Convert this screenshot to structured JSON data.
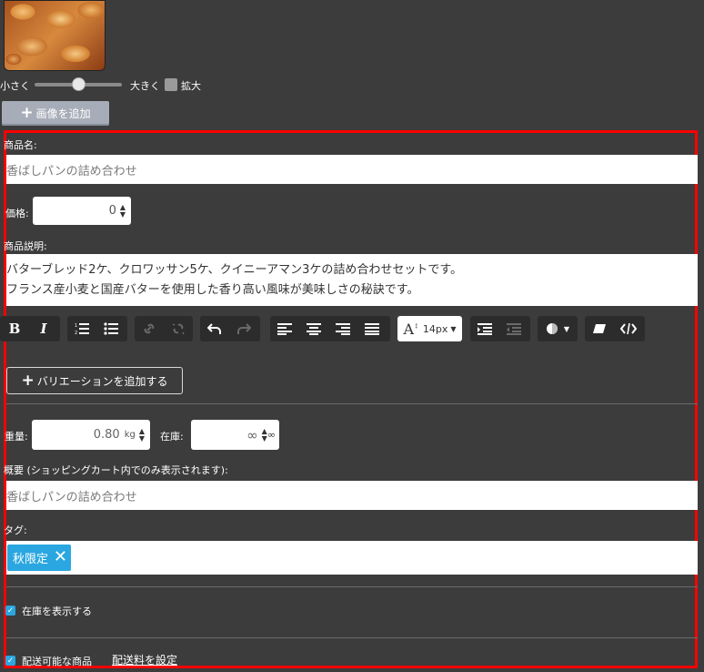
{
  "image_controls": {
    "small_label": "小さく",
    "large_label": "大きく",
    "zoom_label": "拡大",
    "slider_level": 0.5,
    "add_image_label": "画像を追加"
  },
  "product": {
    "name_label": "商品名:",
    "name_value": "香ばしパンの詰め合わせ",
    "price_label": "価格:",
    "price_value": "0",
    "description_label": "商品説明:",
    "description_lines": [
      "バターブレッド2ケ、クロワッサン5ケ、クイニーアマン3ケの詰め合わせセットです。",
      "フランス産小麦と国産バターを使用した香り高い風味が美味しさの秘訣です。"
    ]
  },
  "editor_toolbar": {
    "bold": "B",
    "italic": "I",
    "font_size": "14px"
  },
  "variation_button_label": "バリエーションを追加する",
  "shipping": {
    "weight_label": "重量:",
    "weight_value": "0.80",
    "weight_unit": "kg",
    "stock_label": "在庫:",
    "stock_value": "∞",
    "stock_spin_label": "∞"
  },
  "summary": {
    "label": "概要 (ショッピングカート内でのみ表示されます):",
    "value": "香ばしパンの詰め合わせ"
  },
  "tags": {
    "label": "タグ:",
    "items": [
      "秋限定"
    ]
  },
  "options": {
    "show_stock_label": "在庫を表示する",
    "shippable_label": "配送可能な商品",
    "shipping_fee_link": "配送料を設定"
  },
  "colors": {
    "background": "#3c3c3c",
    "highlight_frame": "#ff0000",
    "tag_chip": "#2aa7e0",
    "checkbox": "#2aa7e0"
  }
}
